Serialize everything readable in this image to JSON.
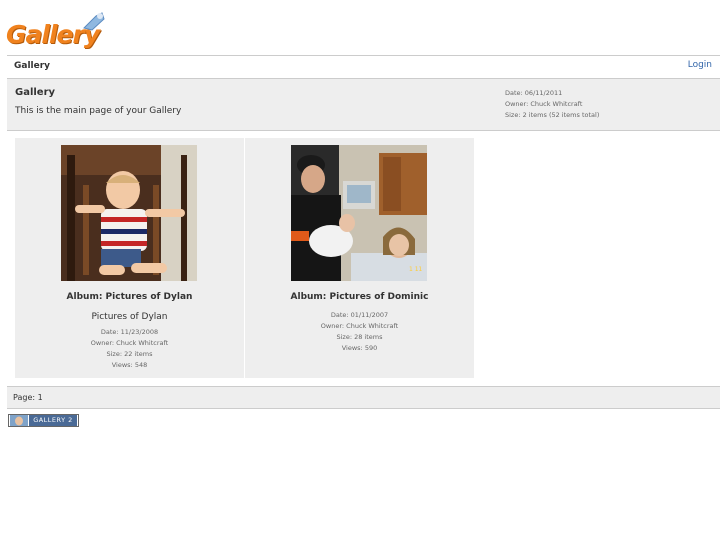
{
  "header": {
    "logo_text": "Gallery",
    "login_label": "Login",
    "breadcrumb": "Gallery"
  },
  "gallery": {
    "title": "Gallery",
    "description": "This is the main page of your Gallery",
    "date": "Date: 06/11/2011",
    "owner": "Owner: Chuck Whitcraft",
    "size": "Size: 2 items (52 items total)"
  },
  "albums": [
    {
      "title": "Album: Pictures of Dylan",
      "subtitle": "Pictures of Dylan",
      "date": "Date: 11/23/2008",
      "owner": "Owner: Chuck Whitcraft",
      "size": "Size: 22 items",
      "views": "Views: 548"
    },
    {
      "title": "Album: Pictures of Dominic",
      "date": "Date: 01/11/2007",
      "owner": "Owner: Chuck Whitcraft",
      "size": "Size: 28 items",
      "views": "Views: 590"
    }
  ],
  "pager": {
    "label": "Page:",
    "current": "1"
  },
  "footer": {
    "badge_text": "GALLERY 2"
  },
  "colors": {
    "logo_orange": "#f0821e",
    "link_blue": "#3366aa",
    "panel_gray": "#eeeeee",
    "badge_blue": "#4a6a96"
  }
}
